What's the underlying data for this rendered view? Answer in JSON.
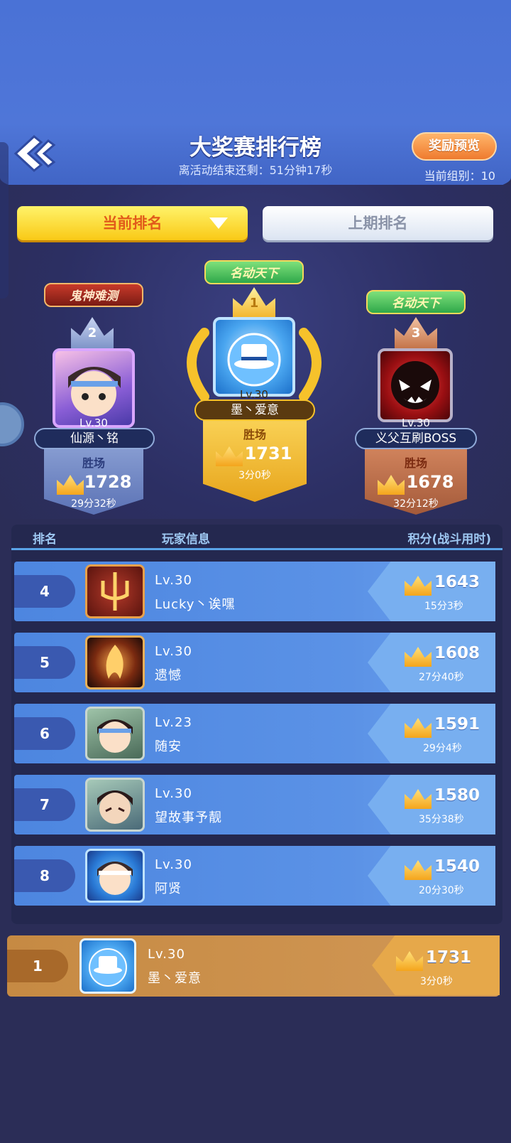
{
  "header": {
    "title": "大奖赛排行榜",
    "countdown": "离活动结束还剩：51分钟17秒",
    "reward_button": "奖励预览",
    "group": "当前组别：10"
  },
  "tabs": [
    {
      "label": "当前排名",
      "active": true
    },
    {
      "label": "上期排名",
      "active": false
    }
  ],
  "podium": [
    {
      "rank": "2",
      "banner": "鬼神难测",
      "level": "Lv.30",
      "name": "仙源丶铭",
      "label": "胜场",
      "score": "1728",
      "time": "29分32秒"
    },
    {
      "rank": "1",
      "banner": "名动天下",
      "level": "Lv.30",
      "name": "墨丶爱意",
      "label": "胜场",
      "score": "1731",
      "time": "3分0秒"
    },
    {
      "rank": "3",
      "banner": "名动天下",
      "level": "Lv.30",
      "name": "义父互刷BOSS",
      "label": "胜场",
      "score": "1678",
      "time": "32分12秒"
    }
  ],
  "table": {
    "headers": {
      "rank": "排名",
      "player": "玩家信息",
      "score": "积分(战斗用时)"
    },
    "rows": [
      {
        "rank": "4",
        "level": "Lv.30",
        "name": "Lucky丶诶嘿",
        "score": "1643",
        "time": "15分3秒"
      },
      {
        "rank": "5",
        "level": "Lv.30",
        "name": "遗憾",
        "score": "1608",
        "time": "27分40秒"
      },
      {
        "rank": "6",
        "level": "Lv.23",
        "name": "随安",
        "score": "1591",
        "time": "29分4秒"
      },
      {
        "rank": "7",
        "level": "Lv.30",
        "name": "望故事予靓",
        "score": "1580",
        "time": "35分38秒"
      },
      {
        "rank": "8",
        "level": "Lv.30",
        "name": "阿贤",
        "score": "1540",
        "time": "20分30秒"
      }
    ]
  },
  "self": {
    "rank": "1",
    "level": "Lv.30",
    "name": "墨丶爱意",
    "score": "1731",
    "time": "3分0秒"
  },
  "colors": {
    "gold": "#f6c22b",
    "silver": "#7e94c8",
    "bronze": "#c4744a",
    "accent": "#f9c916"
  }
}
